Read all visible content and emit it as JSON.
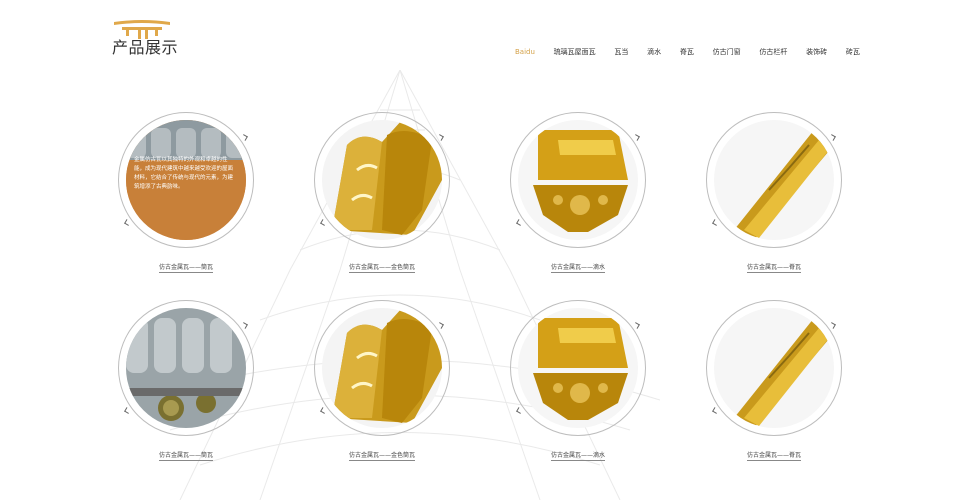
{
  "header": {
    "section_title": "产品展示",
    "brand_color": "#d4a24a"
  },
  "nav": {
    "items": [
      {
        "label": "Baidu"
      },
      {
        "label": "琉璃瓦屋面瓦"
      },
      {
        "label": "瓦当"
      },
      {
        "label": "滴水"
      },
      {
        "label": "脊瓦"
      },
      {
        "label": "仿古门窗"
      },
      {
        "label": "仿古栏杆"
      },
      {
        "label": "装饰砖"
      },
      {
        "label": "砖瓦"
      }
    ],
    "active_index": 0
  },
  "products": [
    {
      "caption": "仿古金属瓦——筒瓦",
      "overlay": "金属仿古瓦以其独特的外观和卓越的性能，成为现代建筑中越来越受欢迎的屋面材料，它结合了传统与现代的元素，为建筑增添了古典韵味。",
      "kind": "tiles"
    },
    {
      "caption": "仿古金属瓦——金色筒瓦",
      "overlay": "",
      "kind": "gold-tile"
    },
    {
      "caption": "仿古金属瓦——滴水",
      "overlay": "",
      "kind": "gold-drip"
    },
    {
      "caption": "仿古金属瓦——脊瓦",
      "overlay": "",
      "kind": "gold-ridge"
    },
    {
      "caption": "仿古金属瓦——筒瓦",
      "overlay": "",
      "kind": "tiles"
    },
    {
      "caption": "仿古金属瓦——金色筒瓦",
      "overlay": "",
      "kind": "gold-tile"
    },
    {
      "caption": "仿古金属瓦——滴水",
      "overlay": "",
      "kind": "gold-drip"
    },
    {
      "caption": "仿古金属瓦——脊瓦",
      "overlay": "",
      "kind": "gold-ridge"
    }
  ]
}
